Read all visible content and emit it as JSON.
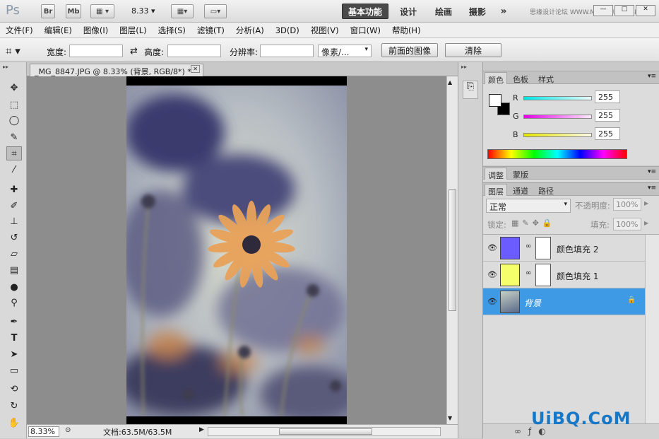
{
  "titlebar": {
    "app_logo": "Ps",
    "bridge": "Br",
    "mini_bridge": "Mb",
    "zoom": "8.33",
    "workspaces": [
      "基本功能",
      "设计",
      "绘画",
      "摄影"
    ],
    "more": "»",
    "site_text": "思缘设计论坛 WWW.MISSYUAN.COM"
  },
  "menubar": {
    "items": [
      "文件(F)",
      "编辑(E)",
      "图像(I)",
      "图层(L)",
      "选择(S)",
      "滤镜(T)",
      "分析(A)",
      "3D(D)",
      "视图(V)",
      "窗口(W)",
      "帮助(H)"
    ]
  },
  "options": {
    "width_label": "宽度:",
    "height_label": "高度:",
    "resolution_label": "分辨率:",
    "unit": "像素/...",
    "front_image": "前面的图像",
    "clear": "清除"
  },
  "document": {
    "tab_title": "_MG_8847.JPG @ 8.33% (背景, RGB/8*) *",
    "zoom": "8.33%",
    "doc_size": "文档:63.5M/63.5M"
  },
  "color_panel": {
    "tabs": [
      "颜色",
      "色板",
      "样式"
    ],
    "channels": [
      {
        "label": "R",
        "value": "255",
        "color": "#00e5e5"
      },
      {
        "label": "G",
        "value": "255",
        "color": "#e500e5"
      },
      {
        "label": "B",
        "value": "255",
        "color": "#e5e500"
      }
    ]
  },
  "adjust_panel": {
    "tabs": [
      "调整",
      "蒙版"
    ]
  },
  "layers_panel": {
    "tabs": [
      "图层",
      "通道",
      "路径"
    ],
    "blend_mode": "正常",
    "opacity_label": "不透明度:",
    "opacity": "100%",
    "lock_label": "锁定:",
    "fill_label": "填充:",
    "fill": "100%",
    "layers": [
      {
        "name": "颜色填充 2",
        "color": "#6b5cff",
        "selected": false
      },
      {
        "name": "颜色填充 1",
        "color": "#f5ff6b",
        "selected": false
      },
      {
        "name": "背景",
        "color": "#5a6a8a",
        "selected": true
      }
    ]
  },
  "watermark": "UiBQ.CoM"
}
